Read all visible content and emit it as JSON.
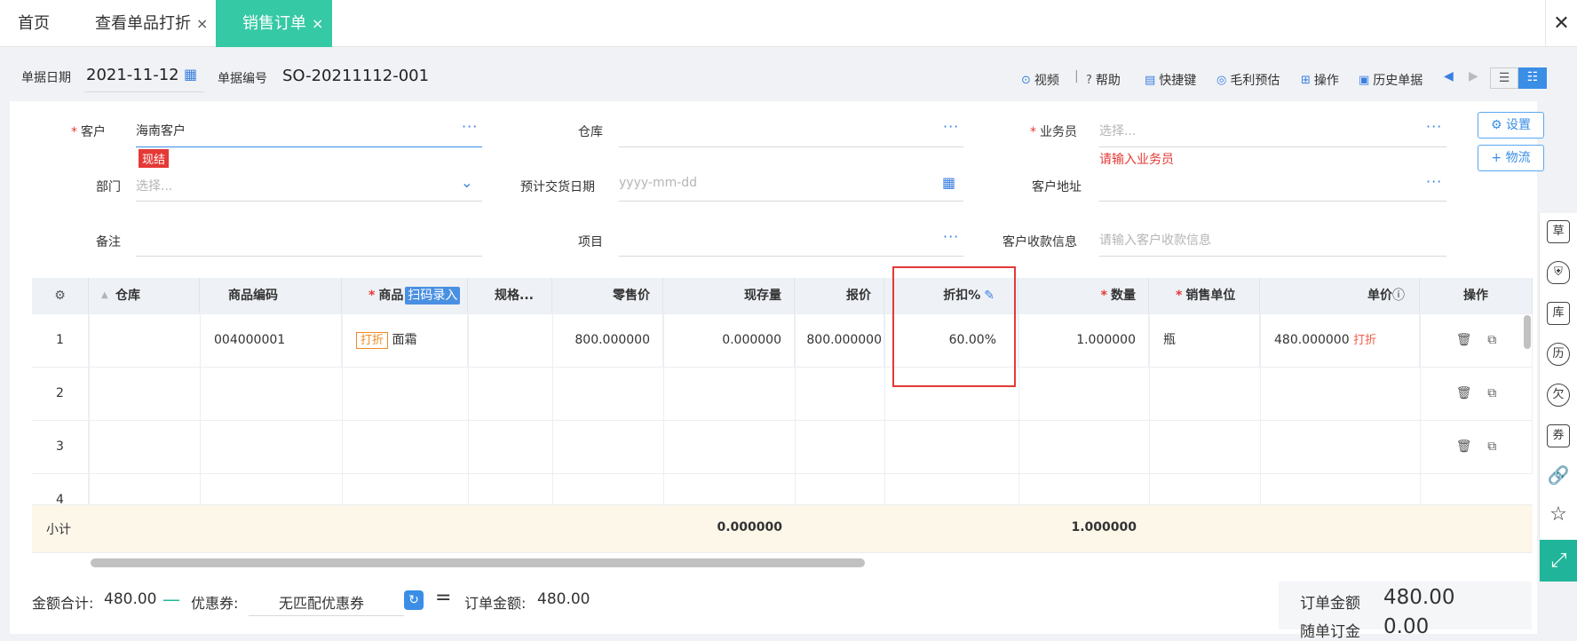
{
  "tabs": {
    "home": "首页",
    "single_discount": "查看单品打折",
    "sales_order": "销售订单",
    "close": "×"
  },
  "window": {
    "close": "✕"
  },
  "header": {
    "date_label": "单据日期",
    "date_value": "2021-11-12",
    "no_label": "单据编号",
    "no_value": "SO-20211112-001",
    "tools": {
      "video": "视频",
      "help": "帮助",
      "shortcut": "快捷键",
      "profit": "毛利预估",
      "operation": "操作",
      "history": "历史单据"
    }
  },
  "form": {
    "customer_label": "客户",
    "customer_value": "海南客户",
    "customer_tag": "现结",
    "warehouse_label": "仓库",
    "salesman_label": "业务员",
    "salesman_placeholder": "选择...",
    "salesman_error": "请输入业务员",
    "settings_btn": "设置",
    "logistics_btn": "物流",
    "dept_label": "部门",
    "dept_placeholder": "选择...",
    "delivery_label": "预计交货日期",
    "delivery_placeholder": "yyyy-mm-dd",
    "address_label": "客户地址",
    "remark_label": "备注",
    "project_label": "项目",
    "payinfo_label": "客户收款信息",
    "payinfo_placeholder": "请输入客户收款信息"
  },
  "grid": {
    "headers": {
      "warehouse": "仓库",
      "code": "商品编码",
      "goods": "商品",
      "scan": "扫码录入",
      "spec": "规格...",
      "retail": "零售价",
      "stock": "现存量",
      "quote": "报价",
      "discount": "折扣%",
      "qty": "数量",
      "unit": "销售单位",
      "price": "单价",
      "ops": "操作"
    },
    "rows": [
      {
        "idx": "1",
        "code": "004000001",
        "tag": "打折",
        "goods": "面霜",
        "retail": "800.000000",
        "stock": "0.000000",
        "quote": "800.000000",
        "discount": "60.00%",
        "qty": "1.000000",
        "unit": "瓶",
        "price": "480.000000",
        "price_tag": "打折"
      },
      {
        "idx": "2"
      },
      {
        "idx": "3"
      },
      {
        "idx": "4"
      }
    ],
    "subtotal_label": "小计",
    "subtotal_stock": "0.000000",
    "subtotal_qty": "1.000000"
  },
  "footer": {
    "amount_label": "金额合计:",
    "amount_value": "480.00",
    "coupon_label": "优惠券:",
    "coupon_placeholder": "无匹配优惠券",
    "order_amount_label": "订单金额:",
    "order_amount_value": "480.00",
    "summary_label": "订单金额",
    "summary_value": "480.00",
    "summary2_label": "随单订金",
    "summary2_value": "0.00"
  },
  "side": {
    "draft": "草",
    "stock": "库",
    "history": "历",
    "owe": "欠",
    "coupon": "券"
  },
  "colors": {
    "accent": "#35c9a5",
    "link": "#3a7fe0",
    "error": "#e53935"
  }
}
